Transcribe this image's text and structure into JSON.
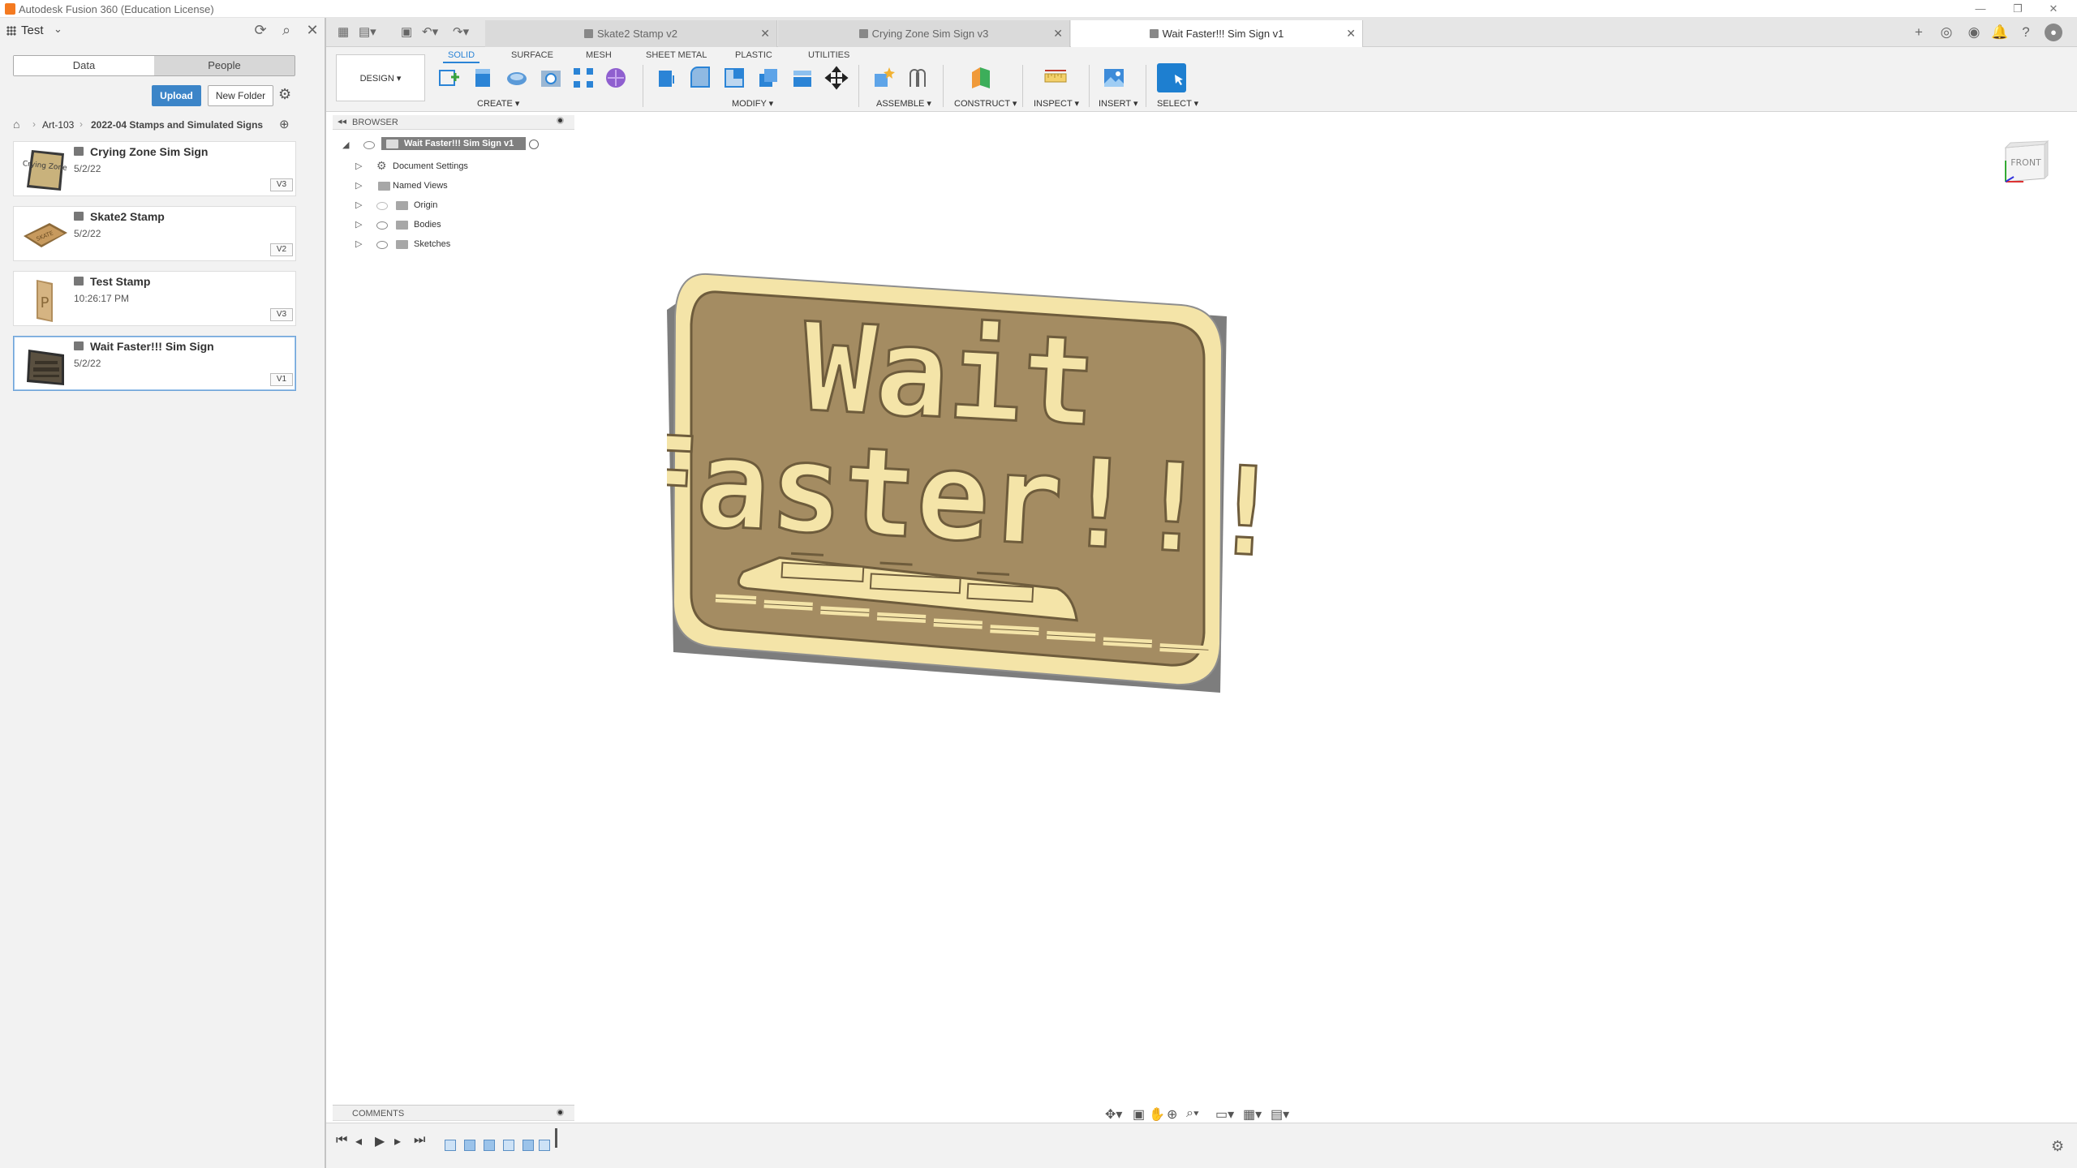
{
  "window": {
    "title": "Autodesk Fusion 360 (Education License)",
    "controls": [
      "—",
      "❐",
      "✕"
    ]
  },
  "left_panel": {
    "project_name": "Test",
    "tabs": [
      "Data",
      "People"
    ],
    "active_tab": "Data",
    "upload_label": "Upload",
    "new_folder_label": "New Folder",
    "breadcrumb": [
      "Art-103",
      "2022-04 Stamps and Simulated Signs"
    ],
    "files": [
      {
        "name": "Crying Zone Sim Sign",
        "date": "5/2/22",
        "version": "V3",
        "thumb_text": "Crying Zone"
      },
      {
        "name": "Skate2 Stamp",
        "date": "5/2/22",
        "version": "V2",
        "thumb_text": "SKATE"
      },
      {
        "name": "Test Stamp",
        "date": "10:26:17 PM",
        "version": "V3",
        "thumb_text": "P"
      },
      {
        "name": "Wait Faster!!! Sim Sign",
        "date": "5/2/22",
        "version": "V1",
        "thumb_text": ""
      }
    ],
    "selected_file": "Wait Faster!!! Sim Sign"
  },
  "doc_tabs": [
    {
      "label": "Skate2 Stamp v2",
      "active": false
    },
    {
      "label": "Crying Zone Sim Sign v3",
      "active": false
    },
    {
      "label": "Wait Faster!!! Sim Sign v1",
      "active": true
    }
  ],
  "toolbar": {
    "workspace": "DESIGN",
    "tabs": [
      "SOLID",
      "SURFACE",
      "MESH",
      "SHEET METAL",
      "PLASTIC",
      "UTILITIES"
    ],
    "active_tab": "SOLID",
    "groups": [
      "CREATE",
      "MODIFY",
      "ASSEMBLE",
      "CONSTRUCT",
      "INSPECT",
      "INSERT",
      "SELECT"
    ]
  },
  "browser": {
    "title": "BROWSER",
    "root": "Wait Faster!!! Sim Sign v1",
    "nodes": [
      "Document Settings",
      "Named Views",
      "Origin",
      "Bodies",
      "Sketches"
    ]
  },
  "viewcube_label": "FRONT",
  "comments_label": "COMMENTS",
  "sign": {
    "line1": "Wait",
    "line2": "Faster!!!",
    "plate_color": "#f4e4a8",
    "recess_color": "#a48c62"
  },
  "colors": {
    "accent": "#2b84d6",
    "upload": "#3c85c8",
    "app_icon": "#f47a20"
  }
}
